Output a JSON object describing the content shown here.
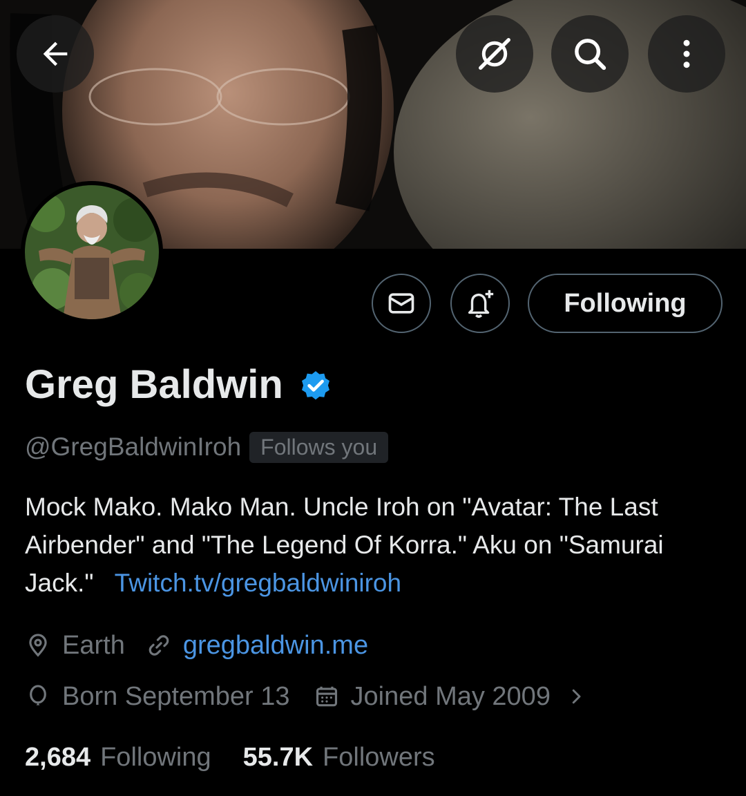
{
  "header": {
    "back_icon": "arrow-left-icon",
    "grok_icon": "grok-icon",
    "search_icon": "search-icon",
    "more_icon": "more-vertical-icon"
  },
  "profile": {
    "name": "Greg Baldwin",
    "verified": true,
    "handle": "@GregBaldwinIroh",
    "follows_you": "Follows you",
    "bio_text": "Mock Mako. Mako Man. Uncle Iroh on \"Avatar: The Last Airbender\" and \"The Legend Of Korra.\" Aku on \"Samurai Jack.\"",
    "bio_link": "Twitch.tv/gregbaldwiniroh",
    "location": "Earth",
    "website": "gregbaldwin.me",
    "birthday": "Born September 13",
    "joined": "Joined May 2009"
  },
  "actions": {
    "following_label": "Following"
  },
  "stats": {
    "following_count": "2,684",
    "following_label": "Following",
    "followers_count": "55.7K",
    "followers_label": "Followers"
  },
  "colors": {
    "background": "#000000",
    "text_primary": "#e7e9ea",
    "text_secondary": "#71767b",
    "link": "#4b95e3",
    "verified": "#1d9bf0",
    "border": "#536471"
  }
}
